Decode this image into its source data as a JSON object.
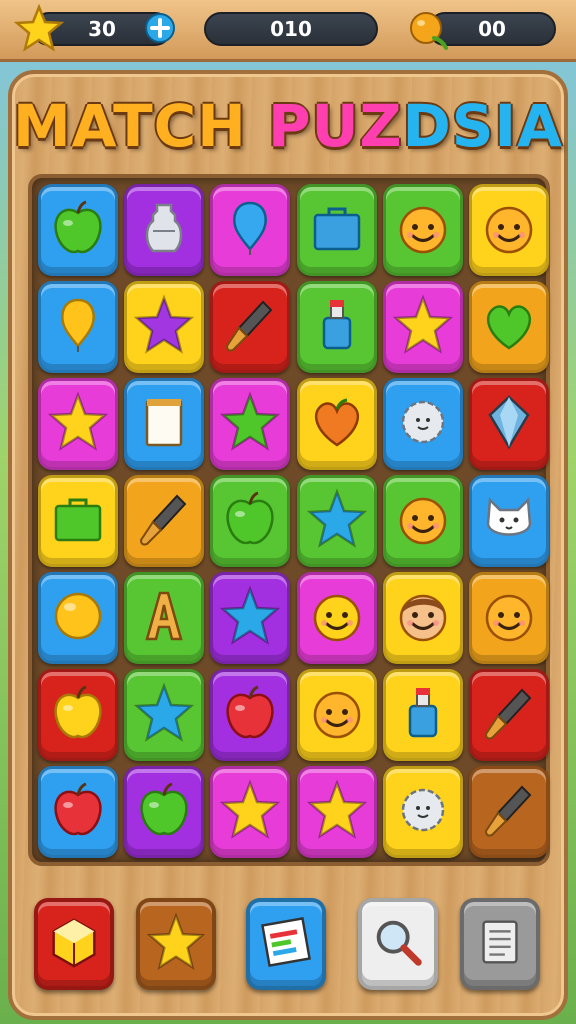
{
  "hud": {
    "stars_value": "30",
    "moves_value": "010",
    "fruit_value": "00",
    "icons": [
      "star-icon",
      "plus-icon",
      "fruit-icon"
    ]
  },
  "title": {
    "part1": "MATCH",
    "part2": "PUZ",
    "part3": "DSIA"
  },
  "colors": {
    "blue": "#2f9ff0",
    "purple": "#a22fe0",
    "pink": "#e83cd8",
    "green": "#58c633",
    "yellow": "#ffd21c",
    "red": "#d8231c",
    "orange": "#f2a51c",
    "brown": "#b8651f"
  },
  "board": [
    [
      {
        "c": "blue",
        "i": "apple-green"
      },
      {
        "c": "purple",
        "i": "vase"
      },
      {
        "c": "pink",
        "i": "balloon"
      },
      {
        "c": "green",
        "i": "box"
      },
      {
        "c": "green",
        "i": "face-orange"
      },
      {
        "c": "yellow",
        "i": "face-orange"
      }
    ],
    [
      {
        "c": "blue",
        "i": "balloon-yellow"
      },
      {
        "c": "yellow",
        "i": "star-purple"
      },
      {
        "c": "red",
        "i": "brush"
      },
      {
        "c": "green",
        "i": "bottle"
      },
      {
        "c": "pink",
        "i": "star-yellow"
      },
      {
        "c": "orange",
        "i": "heart-green"
      }
    ],
    [
      {
        "c": "pink",
        "i": "star-yellow"
      },
      {
        "c": "blue",
        "i": "notepad"
      },
      {
        "c": "pink",
        "i": "star-green"
      },
      {
        "c": "yellow",
        "i": "heart-orange"
      },
      {
        "c": "blue",
        "i": "gear"
      },
      {
        "c": "red",
        "i": "gem"
      }
    ],
    [
      {
        "c": "yellow",
        "i": "box-green"
      },
      {
        "c": "orange",
        "i": "brush"
      },
      {
        "c": "green",
        "i": "apple-green"
      },
      {
        "c": "green",
        "i": "star-blue"
      },
      {
        "c": "green",
        "i": "face-orange"
      },
      {
        "c": "blue",
        "i": "cat"
      }
    ],
    [
      {
        "c": "blue",
        "i": "ball-yellow"
      },
      {
        "c": "green",
        "i": "letter-a"
      },
      {
        "c": "purple",
        "i": "star-blue"
      },
      {
        "c": "pink",
        "i": "face-yellow"
      },
      {
        "c": "yellow",
        "i": "face-boy"
      },
      {
        "c": "orange",
        "i": "face-orange"
      }
    ],
    [
      {
        "c": "red",
        "i": "apple-yellow"
      },
      {
        "c": "green",
        "i": "star-blue"
      },
      {
        "c": "purple",
        "i": "apple-red"
      },
      {
        "c": "yellow",
        "i": "face-orange"
      },
      {
        "c": "yellow",
        "i": "bottle"
      },
      {
        "c": "red",
        "i": "brush"
      }
    ],
    [
      {
        "c": "blue",
        "i": "apple-red"
      },
      {
        "c": "purple",
        "i": "apple-green"
      },
      {
        "c": "pink",
        "i": "star-yellow"
      },
      {
        "c": "pink",
        "i": "star-yellow"
      },
      {
        "c": "yellow",
        "i": "gear"
      },
      {
        "c": "brown",
        "i": "brush"
      }
    ]
  ],
  "buttons": [
    {
      "name": "cube-button",
      "c": "red",
      "i": "cube"
    },
    {
      "name": "star-button",
      "c": "brown",
      "i": "star-yellow"
    },
    {
      "name": "chart-button",
      "c": "blue",
      "i": "chart"
    },
    {
      "name": "search-button",
      "c": "white",
      "i": "magnifier"
    },
    {
      "name": "menu-button",
      "c": "gray",
      "i": "list"
    }
  ]
}
